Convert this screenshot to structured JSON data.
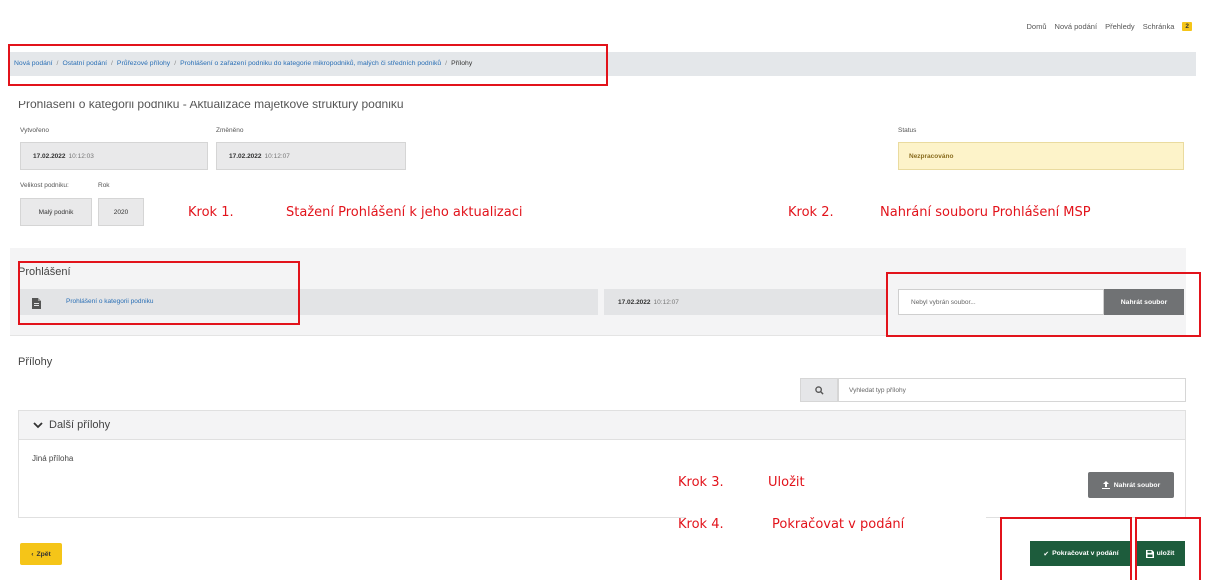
{
  "topnav": {
    "home": "Domů",
    "new_submission": "Nová podání",
    "overviews": "Přehledy",
    "inbox": "Schránka",
    "inbox_count": "2"
  },
  "breadcrumb": {
    "items": [
      "Nová podání",
      "Ostatní podání",
      "Průřezové přílohy",
      "Prohlášení o zařazení podniku do kategorie mikropodniků, malých či středních podniků"
    ],
    "current": "Přílohy",
    "separator": "/"
  },
  "page": {
    "title": "Prohlášení o kategorii podniku - Aktualizace majetkové struktury podniku"
  },
  "meta": {
    "created_label": "Vytvořeno",
    "created_date": "17.02.2022",
    "created_time": "10:12:03",
    "changed_label": "Změněno",
    "changed_date": "17.02.2022",
    "changed_time": "10:12:07",
    "status_label": "Status",
    "status_value": "Nezpracováno",
    "status_color": "#fdf3c9",
    "size_label": "Velikost podniku:",
    "size_value": "Malý podnik",
    "year_label": "Rok",
    "year_value": "2020"
  },
  "annotations": {
    "step1_num": "Krok 1.",
    "step1_text": "Stažení Prohlášení k jeho aktualizaci",
    "step2_num": "Krok 2.",
    "step2_text": "Nahrání souboru Prohlášení MSP",
    "step3_num": "Krok 3.",
    "step3_text": "Uložit",
    "step4_num": "Krok 4.",
    "step4_text": "Pokračovat v podání",
    "highlight_color": "#e2131b"
  },
  "declaration": {
    "section_title": "Prohlášení",
    "doc_link": "Prohlášení o kategorii podniku",
    "doc_date": "17.02.2022",
    "doc_time": "10:12:07",
    "file_placeholder": "Nebyl vybrán soubor...",
    "upload_label": "Nahrát soubor"
  },
  "attachments": {
    "section_title": "Přílohy",
    "search_placeholder": "Vyhledat typ přílohy",
    "panel_title": "Další přílohy",
    "item_label": "Jiná příloha",
    "upload_label": "Nahrát soubor"
  },
  "footer": {
    "back_label": "Zpět",
    "continue_label": "Pokračovat v podání",
    "save_label": "uložit",
    "primary_color": "#1d5c3c",
    "back_color": "#f5c518"
  }
}
